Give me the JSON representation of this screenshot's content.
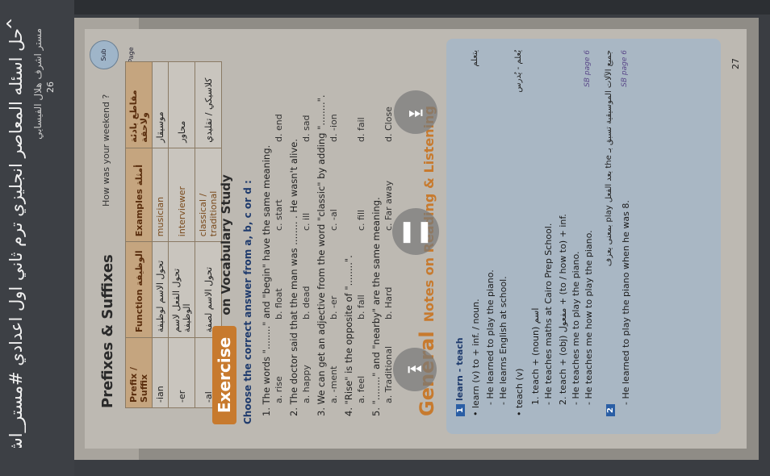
{
  "header": {
    "title": "حل اسئله المعاصر انجليزي ترم ثاني اول اعدادي #مستر_اش",
    "subtitle": "مستر اشرف هلال الفيسابي",
    "page_left_indicator": "26"
  },
  "book": {
    "prefixes_title": "Prefixes & Suffixes",
    "question_line": "How was your weekend ?",
    "badge": "Sub Page",
    "table_headers": [
      "Prefix / Suffix",
      "Function الوظيفة",
      "Examples أمثلة"
    ],
    "table_header_ar": "مقاطع بادئة ولاحقة",
    "table_rows": [
      {
        "suffix": "-ian",
        "function": "تحول الاسم لوظيفة",
        "example": "musician",
        "ar": "موسيقار"
      },
      {
        "suffix": "-er",
        "function": "تحول الفعل لاسم الوظيفة",
        "example": "interviewer",
        "ar": "محاور"
      },
      {
        "suffix": "-al",
        "function": "تحول الاسم لصفة",
        "example": "classical / traditional",
        "ar": "كلاسيكي / تقليدي"
      }
    ],
    "exercise_label": "Exercise",
    "exercise_sub": "on Vocabulary Study",
    "instruction": "Choose the correct answer from a, b, c or d :",
    "questions": [
      {
        "text": "1. The words \"........\" and \"begin\" have the same meaning.",
        "options": [
          "a. rise",
          "b. float",
          "c. start",
          "d. end"
        ]
      },
      {
        "text": "2. The doctor said that the man was ........ . He wasn't alive.",
        "options": [
          "a. happy",
          "b. dead",
          "c. ill",
          "d. sad"
        ]
      },
      {
        "text": "3. We can get an adjective from the word \"classic\" by adding \"........\".",
        "options": [
          "a. -ment",
          "b. -er",
          "c. -al",
          "d. -ion"
        ]
      },
      {
        "text": "4. \"Rise\" is the opposite of \"........\".",
        "options": [
          "a. feel",
          "b. fall",
          "c. fill",
          "d. fail"
        ]
      },
      {
        "text": "5. \"........\" and \"nearby\" are the same meaning.",
        "options": [
          "a. Traditional",
          "b. Hard",
          "c. Far away",
          "d. Close"
        ]
      }
    ],
    "general_big": "General",
    "general_rest": "Notes on Reading & Listening",
    "notes": [
      "learn - teach",
      "• learn (v) to + inf. / noun.",
      "- He learned to play the piano.",
      "- He learns English at school.",
      "• teach (v)",
      "1. teach + (noun) اسم",
      "- He teaches maths at Cairo Prep School.",
      "2. teach + (obj) مفعول + (to / how to) + inf.",
      "- He teaches me to play the piano.",
      "- He teaches me how to play the piano.",
      "- He learned to play the piano when he was 8."
    ],
    "note_ar_1": "يتعلم",
    "note_ar_2": "يُعلم - يُدرس",
    "sb_page": "SB page 6",
    "sb_page2": "SB page 6",
    "play_note_ar": "جميع الآلات الموسيقية تسبق بـ the بعد الفعل play بمعنى يعزف",
    "page_number": "27"
  },
  "controls": {
    "prev": "⏮",
    "pause": "❚❚",
    "next": "⏭"
  }
}
